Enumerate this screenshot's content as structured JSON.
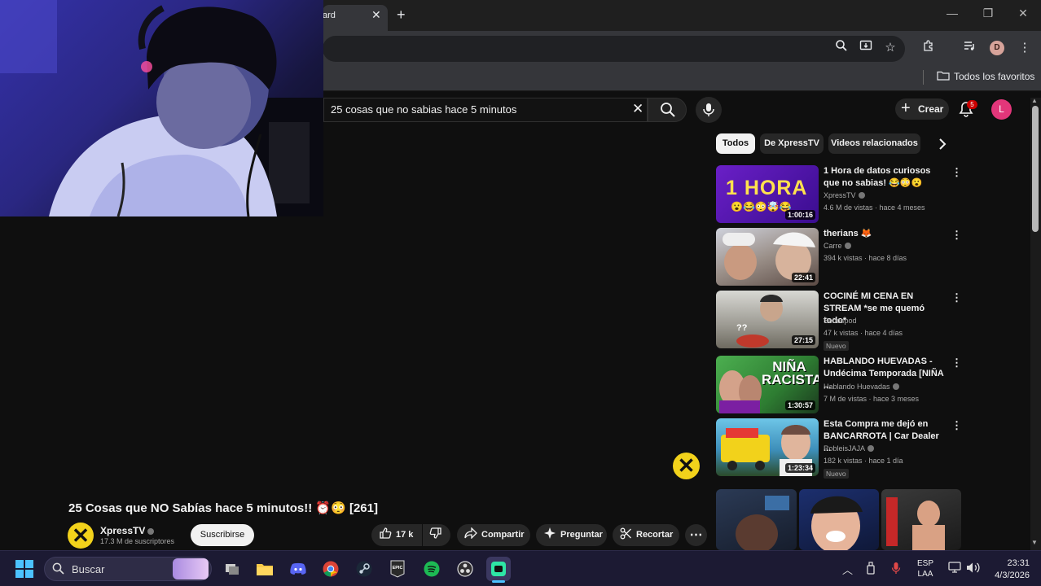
{
  "browser": {
    "tab_title": "ard",
    "bookmarks_folder": "Todos los favoritos",
    "profile_initial": "D"
  },
  "youtube": {
    "search_query": "25 cosas que no sabias hace 5 minutos",
    "crear_label": "Crear",
    "notification_count": "5",
    "avatar_initial": "L",
    "chips": [
      "Todos",
      "De XpressTV",
      "Videos relacionados"
    ],
    "video": {
      "title": "25 Cosas que NO Sabías hace 5 minutos!! ⏰😳 [261]",
      "channel": "XpressTV",
      "subscribers": "17.3 M de suscriptores",
      "subscribe_label": "Suscribirse",
      "likes": "17 k",
      "share_label": "Compartir",
      "ask_label": "Preguntar",
      "clip_label": "Recortar"
    },
    "recommendations": [
      {
        "title": "1 Hora de datos curiosos que no sabias! 😂😳😮",
        "channel": "XpressTV",
        "meta": "4.6 M de vistas · hace 4 meses",
        "duration": "1:00:16",
        "nuevo": "",
        "thumb_text": "1 HORA"
      },
      {
        "title": "therians 🦊",
        "channel": "Carre",
        "meta": "394 k vistas · hace 8 días",
        "duration": "22:41",
        "nuevo": "",
        "thumb_text": ""
      },
      {
        "title": "COCINÉ MI CENA EN STREAM *se me quemó todo*",
        "channel": "Sebaspod",
        "meta": "47 k vistas · hace 4 días",
        "duration": "27:15",
        "nuevo": "Nuevo",
        "thumb_text": "??"
      },
      {
        "title": "HABLANDO HUEVADAS - Undécima Temporada [NIÑA ...",
        "channel": "Hablando Huevadas",
        "meta": "7 M de vistas · hace 3 meses",
        "duration": "1:30:57",
        "nuevo": "",
        "thumb_text": "NIÑA RACISTA"
      },
      {
        "title": "Esta Compra me dejó en BANCARROTA | Car Dealer ...",
        "channel": "RobleisJAJA",
        "meta": "182 k vistas · hace 1 día",
        "duration": "1:23:34",
        "nuevo": "Nuevo",
        "thumb_text": ""
      }
    ]
  },
  "taskbar": {
    "search_label": "Buscar",
    "lang_line1": "ESP",
    "lang_line2": "LAA",
    "time": "23:31",
    "date": "4/3/2026"
  }
}
